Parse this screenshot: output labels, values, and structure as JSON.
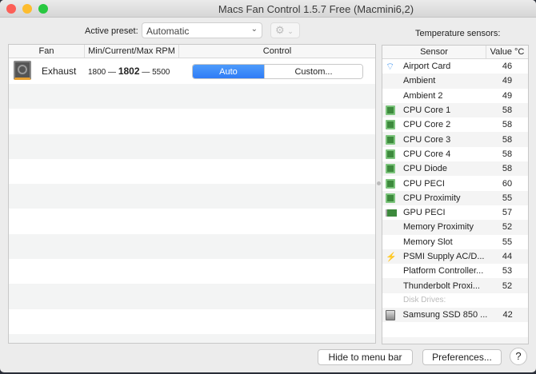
{
  "window": {
    "title": "Macs Fan Control 1.5.7 Free (Macmini6,2)"
  },
  "toolbar": {
    "preset_label": "Active preset:",
    "preset_value": "Automatic",
    "gear_icon": "gear-icon"
  },
  "fans": {
    "columns": [
      "Fan",
      "Min/Current/Max RPM",
      "Control"
    ],
    "rows": [
      {
        "name": "Exhaust",
        "min": "1800",
        "current": "1802",
        "max": "5500",
        "sep": "—",
        "control": {
          "auto": "Auto",
          "custom": "Custom...",
          "selected": "Auto"
        }
      }
    ]
  },
  "sensors": {
    "title": "Temperature sensors:",
    "columns": [
      "Sensor",
      "Value °C"
    ],
    "rows": [
      {
        "name": "Airport Card",
        "value": "46",
        "icon": "wifi"
      },
      {
        "name": "Ambient",
        "value": "49",
        "icon": ""
      },
      {
        "name": "Ambient 2",
        "value": "49",
        "icon": ""
      },
      {
        "name": "CPU Core 1",
        "value": "58",
        "icon": "chip"
      },
      {
        "name": "CPU Core 2",
        "value": "58",
        "icon": "chip"
      },
      {
        "name": "CPU Core 3",
        "value": "58",
        "icon": "chip"
      },
      {
        "name": "CPU Core 4",
        "value": "58",
        "icon": "chip"
      },
      {
        "name": "CPU Diode",
        "value": "58",
        "icon": "chip"
      },
      {
        "name": "CPU PECI",
        "value": "60",
        "icon": "chip"
      },
      {
        "name": "CPU Proximity",
        "value": "55",
        "icon": "chip"
      },
      {
        "name": "GPU PECI",
        "value": "57",
        "icon": "gpu"
      },
      {
        "name": "Memory Proximity",
        "value": "52",
        "icon": ""
      },
      {
        "name": "Memory Slot",
        "value": "55",
        "icon": ""
      },
      {
        "name": "PSMI Supply AC/D...",
        "value": "44",
        "icon": "bolt"
      },
      {
        "name": "Platform Controller...",
        "value": "53",
        "icon": ""
      },
      {
        "name": "Thunderbolt Proxi...",
        "value": "52",
        "icon": ""
      },
      {
        "name": "Disk Drives:",
        "value": "",
        "icon": "",
        "group": true
      },
      {
        "name": "Samsung SSD 850 ...",
        "value": "42",
        "icon": "disk"
      }
    ]
  },
  "footer": {
    "hide": "Hide to menu bar",
    "prefs": "Preferences...",
    "help": "?"
  },
  "colors": {
    "accent": "#3b82f6",
    "close": "#fc5f57",
    "minimize": "#fdbc2e",
    "zoom": "#28c840"
  }
}
